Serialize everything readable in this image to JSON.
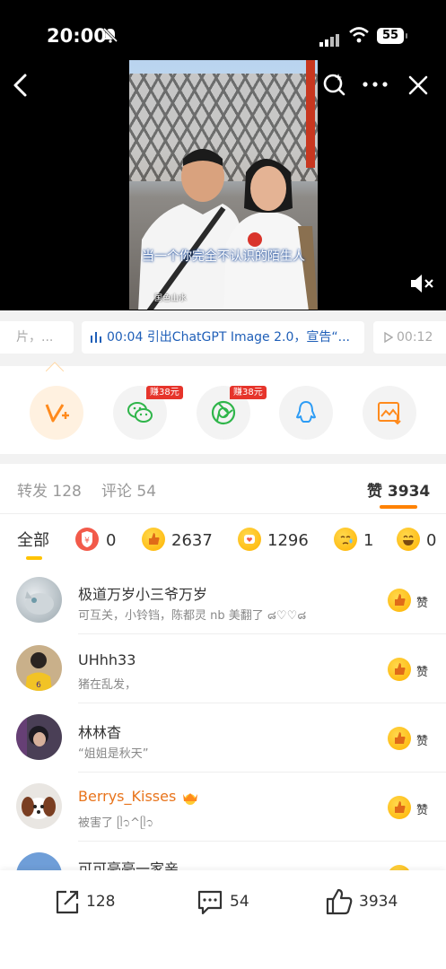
{
  "status": {
    "time": "20:00",
    "battery": "55"
  },
  "video": {
    "subtitle": "当一个你完全不认识的陌生人",
    "caption": "国色山水"
  },
  "chapters": [
    {
      "label": "片，..."
    },
    {
      "time": "00:04",
      "label": "引出ChatGPT Image 2.0，宣告“..."
    },
    {
      "label": "00:12"
    }
  ],
  "share": {
    "wechat_badge": "赚38元",
    "moments_badge": "赚38元"
  },
  "tabs": {
    "repost": "转发 128",
    "comment": "评论 54",
    "like_label": "赞",
    "like_count": "3934"
  },
  "filters": {
    "all": "全部",
    "r1": "0",
    "r2": "2637",
    "r3": "1296",
    "r4": "1",
    "r5": "0"
  },
  "likers": [
    {
      "name": "极道万岁小三爷万岁",
      "comment": "可互关，小铃铛，陈都灵 nb 美翻了 ๘♡♡๘",
      "like": "赞"
    },
    {
      "name": "UHhh33",
      "comment": "猪在乱发，",
      "like": "赞"
    },
    {
      "name": "林林杳",
      "comment": "“姐姐是秋天”",
      "like": "赞"
    },
    {
      "name": "Berrys_Kisses",
      "comment": "被害了 ᥫ᭡^ᥫ᭡",
      "like": "赞"
    },
    {
      "name": "可可毫毫一家亲",
      "comment": "",
      "like": "赞"
    }
  ],
  "bottom": {
    "repost": "128",
    "comment": "54",
    "like": "3934"
  },
  "colors": {
    "accent": "#ff8200",
    "link": "#1f5fb8",
    "badge": "#e6342b",
    "vip_name": "#e8741c"
  }
}
